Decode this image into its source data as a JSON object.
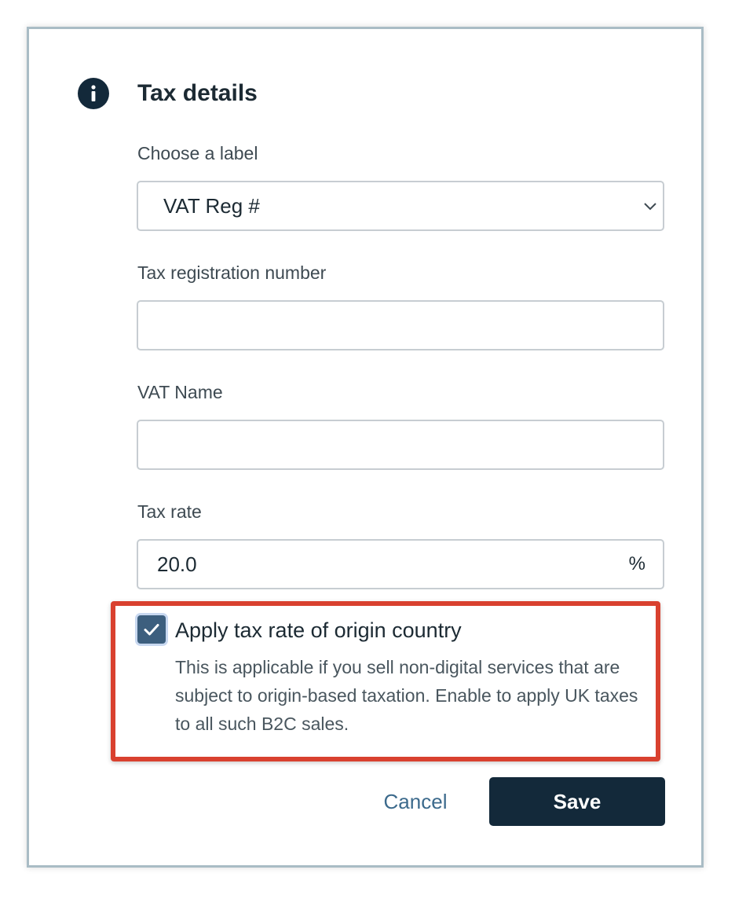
{
  "dialog": {
    "title": "Tax details",
    "icon": "info-icon"
  },
  "fields": {
    "label_select": {
      "label": "Choose a label",
      "value": "VAT Reg #"
    },
    "registration_number": {
      "label": "Tax registration number",
      "value": ""
    },
    "vat_name": {
      "label": "VAT Name",
      "value": ""
    },
    "tax_rate": {
      "label": "Tax rate",
      "value": "20.0",
      "suffix": "%"
    }
  },
  "origin_option": {
    "checked": true,
    "label": "Apply tax rate of origin country",
    "help": "This is applicable if you sell non-digital services that are subject to origin-based taxation. Enable to apply UK taxes to all such B2C sales."
  },
  "actions": {
    "cancel_label": "Cancel",
    "save_label": "Save"
  },
  "colors": {
    "primary": "#13293a",
    "highlight": "#d9412f",
    "link": "#3c6a8c"
  }
}
